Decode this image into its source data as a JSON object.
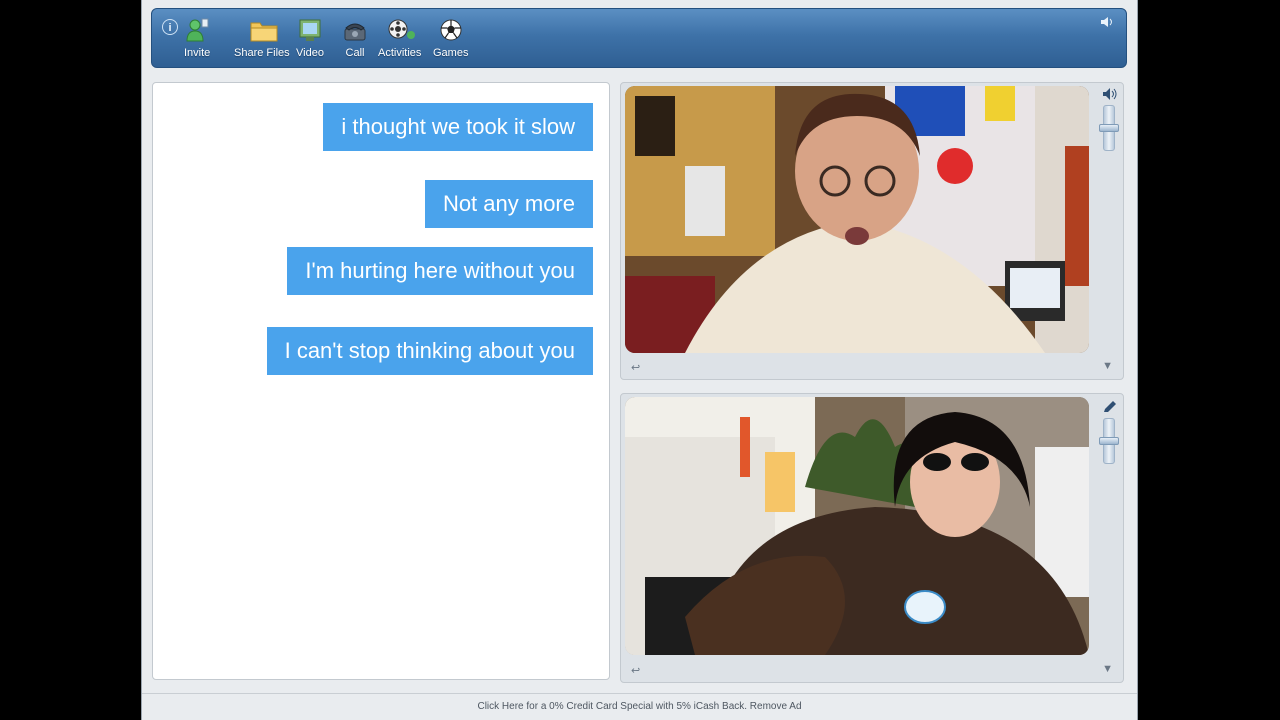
{
  "toolbar": {
    "info_glyph": "i",
    "buttons": [
      {
        "label": "Invite",
        "icon": "invite-icon"
      },
      {
        "label": "Share Files",
        "icon": "folder-icon"
      },
      {
        "label": "Video",
        "icon": "video-icon"
      },
      {
        "label": "Call",
        "icon": "phone-icon"
      },
      {
        "label": "Activities",
        "icon": "activities-icon"
      },
      {
        "label": "Games",
        "icon": "games-icon"
      }
    ]
  },
  "chat": {
    "messages": [
      "i thought we took it slow",
      "Not any more",
      "I'm hurting here without you",
      "I can't stop thinking about you"
    ]
  },
  "video_panels": [
    {
      "name": "remote-video",
      "top_icon": "speaker-icon",
      "bottom_left_icon": "arrow-icon",
      "bottom_right_icon": "dropdown-icon"
    },
    {
      "name": "local-video",
      "top_icon": "pencil-icon",
      "bottom_left_icon": "arrow-icon",
      "bottom_right_icon": "dropdown-icon"
    }
  ],
  "status_bar": {
    "text": "Click Here for a 0% Credit Card Special with 5% iCash Back. Remove Ad"
  },
  "colors": {
    "bubble": "#4aa3ec",
    "toolbar": "#3e72a8"
  }
}
